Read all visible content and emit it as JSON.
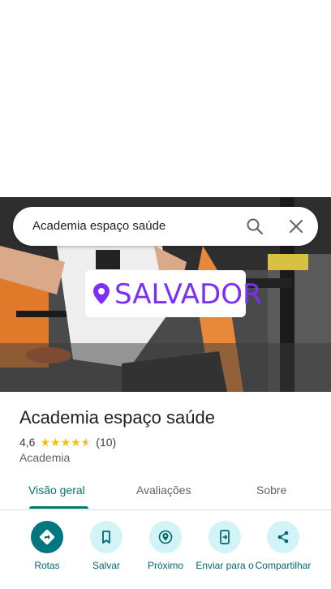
{
  "search": {
    "query": "Academia espaço saúde"
  },
  "photo": {
    "sticker_text": "SALVADOR"
  },
  "place": {
    "name": "Academia espaço saúde",
    "rating": "4,6",
    "stars": 4.6,
    "reviews": "(10)",
    "category": "Academia"
  },
  "tabs": [
    {
      "label": "Visão geral"
    },
    {
      "label": "Avaliações"
    },
    {
      "label": "Sobre"
    }
  ],
  "actions": [
    {
      "label": "Rotas",
      "icon": "directions-icon"
    },
    {
      "label": "Salvar",
      "icon": "bookmark-icon"
    },
    {
      "label": "Próximo",
      "icon": "nearby-icon"
    },
    {
      "label": "Enviar para o",
      "icon": "send-to-phone-icon"
    },
    {
      "label": "Compartilhar",
      "icon": "share-icon"
    }
  ],
  "colors": {
    "accent": "#00796b",
    "star": "#fbbc04",
    "sticker": "#7b2ff7"
  }
}
